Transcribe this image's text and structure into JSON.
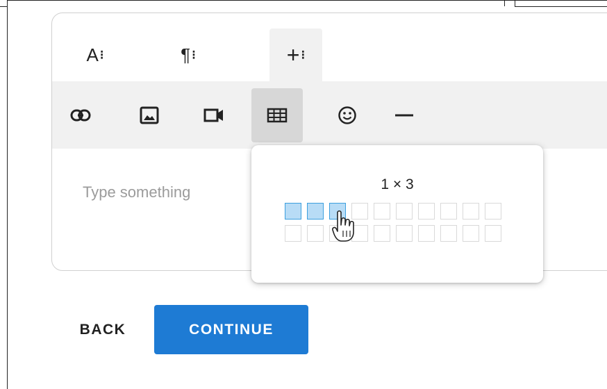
{
  "tabs": [
    {
      "label": "A",
      "name": "text-format-tab"
    },
    {
      "label": "¶",
      "name": "paragraph-format-tab"
    },
    {
      "label": "+",
      "name": "insert-tab"
    }
  ],
  "tab_dots": "⁝",
  "toolbar": {
    "tools": [
      "link-icon",
      "image-icon",
      "video-icon",
      "table-icon",
      "emoji-icon",
      "horizontal-line-icon"
    ]
  },
  "editor": {
    "placeholder": "Type something"
  },
  "table_picker": {
    "size_label": "1 × 3",
    "rows": 2,
    "columns": 10,
    "selected_rows": 1,
    "selected_columns": 3,
    "selected_color": "#b8dcf6",
    "selected_border_color": "#3c9fde"
  },
  "actions": {
    "back_label": "BACK",
    "continue_label": "CONTINUE",
    "continue_color": "#1e7bd4"
  }
}
